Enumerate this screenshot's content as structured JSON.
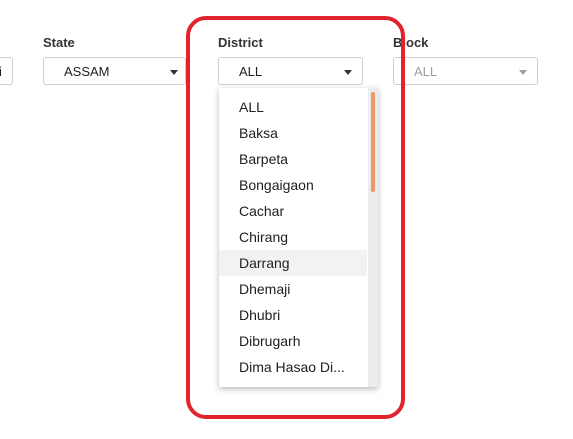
{
  "filters": {
    "left_partial": {
      "value": "i"
    },
    "state": {
      "label": "State",
      "value": "ASSAM"
    },
    "district": {
      "label": "District",
      "value": "ALL"
    },
    "block": {
      "label": "Block",
      "value": "ALL",
      "disabled": true
    }
  },
  "district_dropdown": {
    "options": [
      "ALL",
      "Baksa",
      "Barpeta",
      "Bongaigaon",
      "Cachar",
      "Chirang",
      "Darrang",
      "Dhemaji",
      "Dhubri",
      "Dibrugarh",
      "Dima Hasao Di..."
    ],
    "hovered_option": "Darrang"
  },
  "colors": {
    "highlight_border": "#e3232c",
    "scroll_thumb": "#f0956a",
    "hover_bg": "#f2f2f2"
  },
  "icons": [
    "chevron-down-icon"
  ]
}
